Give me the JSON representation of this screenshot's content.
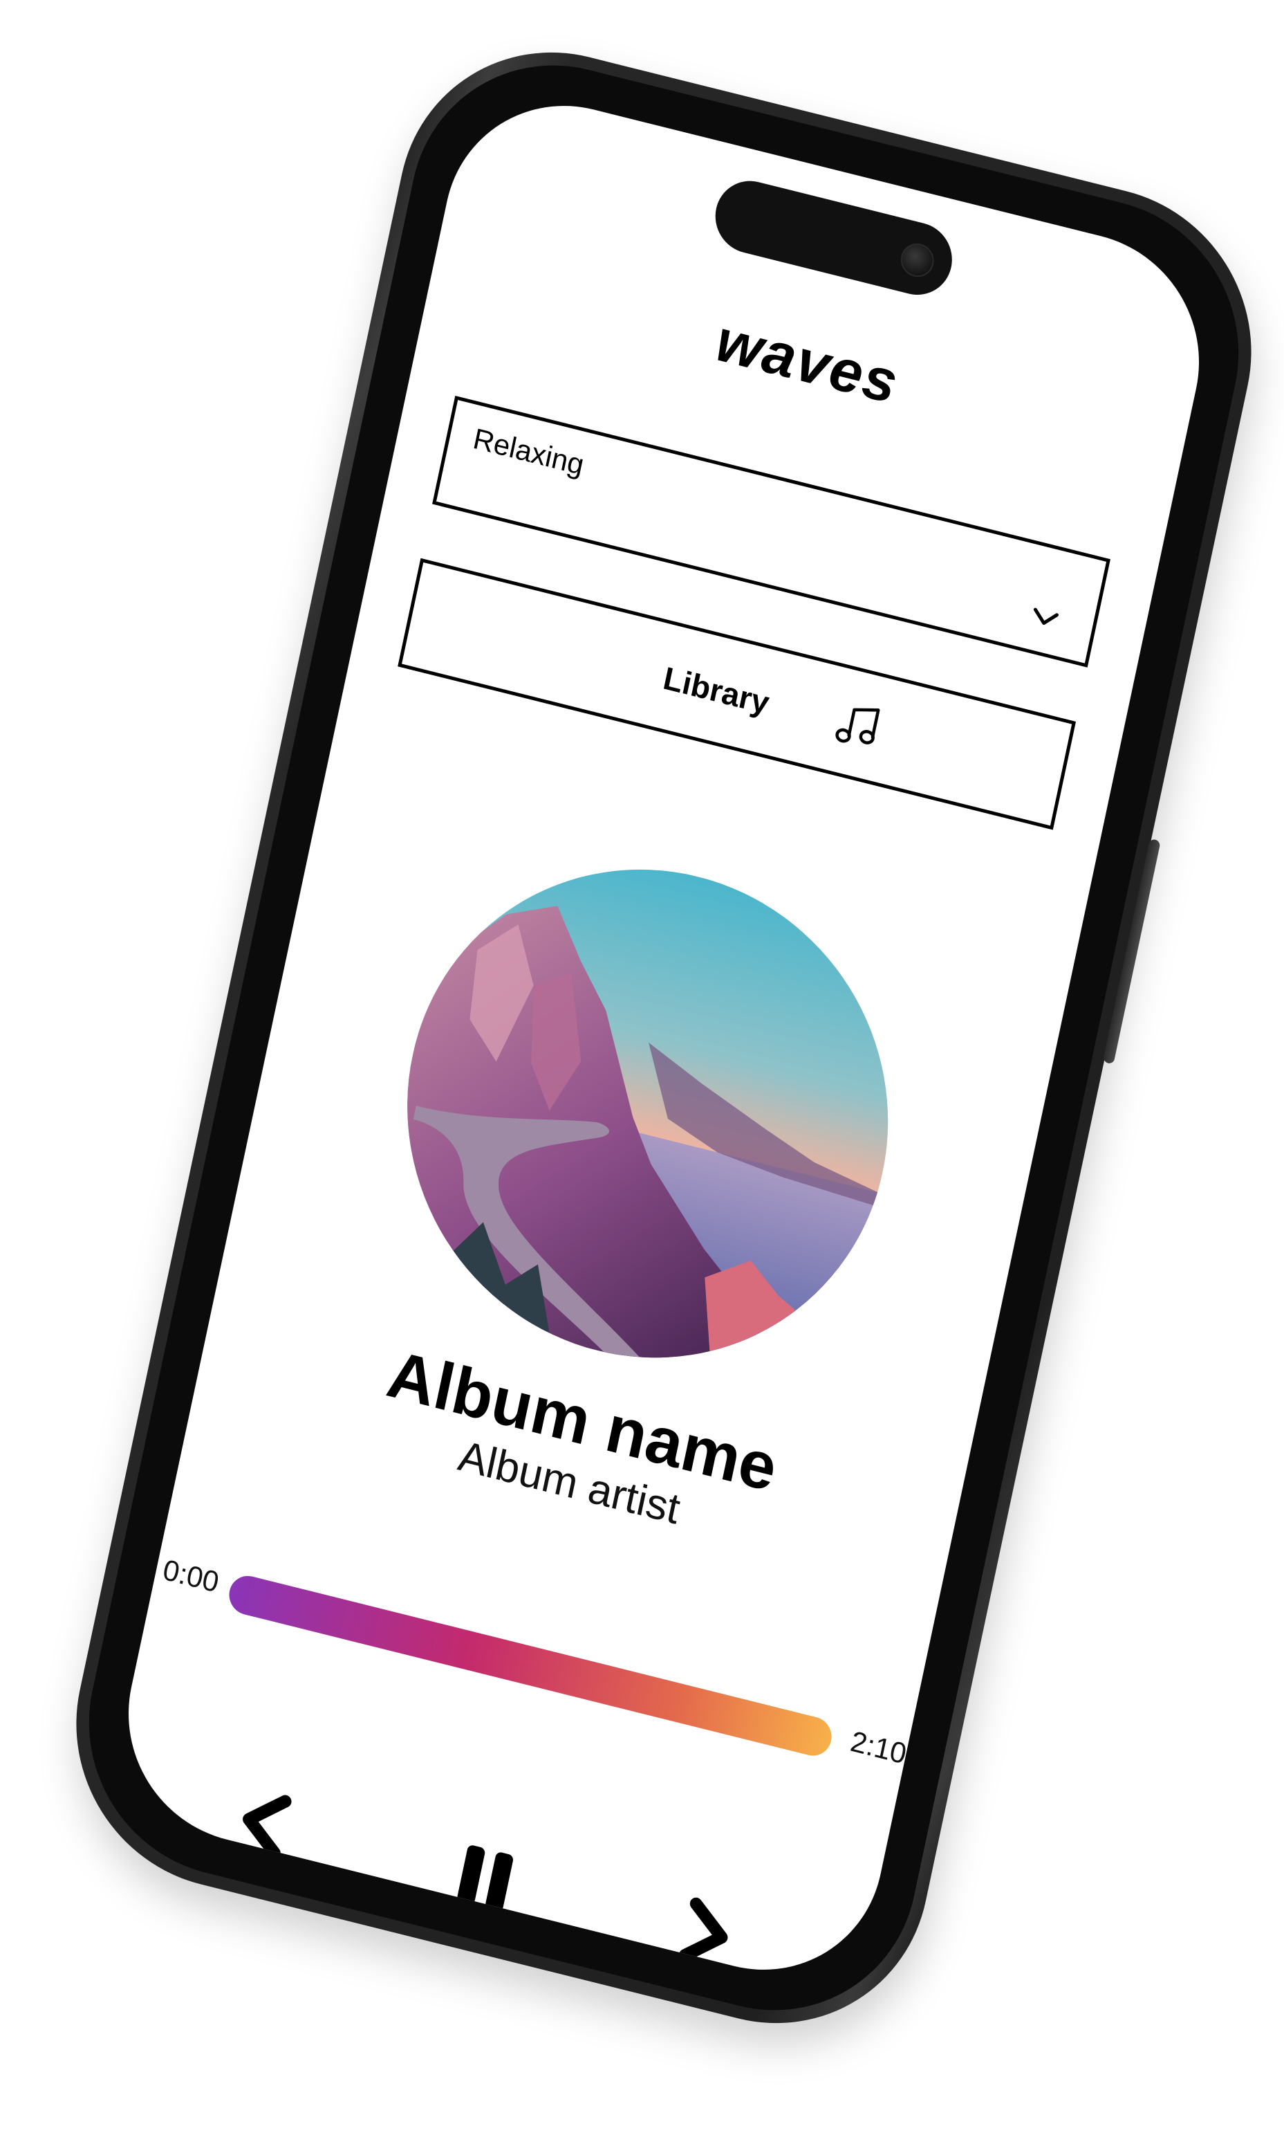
{
  "app": {
    "title": "waves"
  },
  "mood_select": {
    "selected": "Relaxing",
    "icon": "chevron-down-icon"
  },
  "library": {
    "label": "Library",
    "icon": "music-note-icon"
  },
  "album": {
    "name": "Album name",
    "artist": "Album artist"
  },
  "player": {
    "time_start": "0:00",
    "time_end": "2:10",
    "progress": 1.0,
    "gradient_colors": [
      "#8a35b8",
      "#c42a6c",
      "#e46a4c",
      "#f8b14a"
    ],
    "controls": {
      "prev_icon": "previous-icon",
      "pause_icon": "pause-icon",
      "next_icon": "next-icon"
    }
  }
}
